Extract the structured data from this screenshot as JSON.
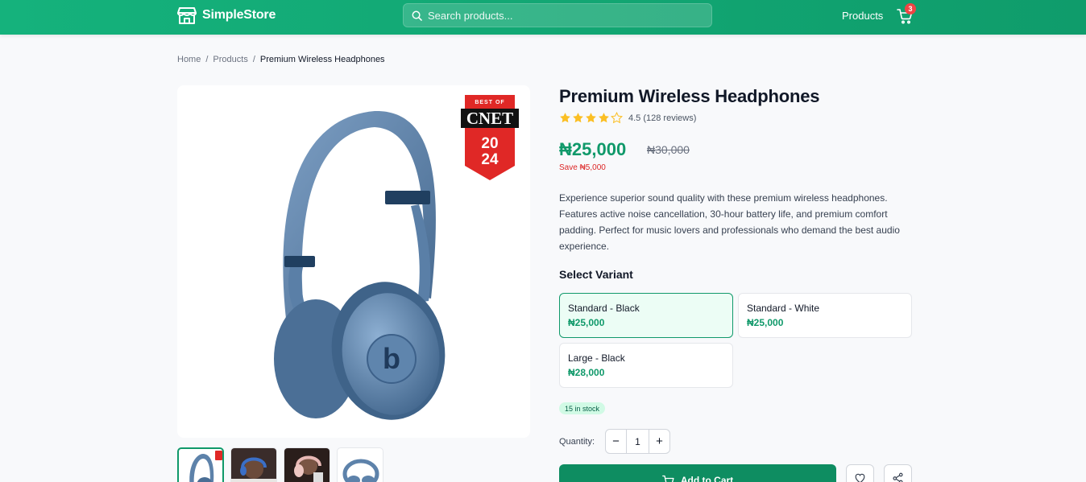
{
  "header": {
    "brand": "SimpleStore",
    "search_placeholder": "Search products...",
    "nav_products": "Products",
    "cart_count": "3"
  },
  "breadcrumb": {
    "home": "Home",
    "products": "Products",
    "current": "Premium Wireless Headphones",
    "separator": "/"
  },
  "image": {
    "badge_top": "BEST OF",
    "badge_brand": "CNET",
    "badge_year_1": "20",
    "badge_year_2": "24",
    "headphone_logo": "b"
  },
  "product": {
    "title": "Premium Wireless Headphones",
    "rating": 4.5,
    "rating_text": "4.5 (128 reviews)",
    "price": "₦25,000",
    "old_price": "₦30,000",
    "save": "Save ₦5,000",
    "description": "Experience superior sound quality with these premium wireless headphones. Features active noise cancellation, 30-hour battery life, and premium comfort padding. Perfect for music lovers and professionals who demand the best audio experience.",
    "variant_label": "Select Variant",
    "variants": [
      {
        "name": "Standard - Black",
        "price": "₦25,000",
        "selected": true
      },
      {
        "name": "Standard - White",
        "price": "₦25,000",
        "selected": false
      },
      {
        "name": "Large - Black",
        "price": "₦28,000",
        "selected": false
      }
    ],
    "stock": "15 in stock",
    "quantity_label": "Quantity:",
    "quantity": "1",
    "add_to_cart": "Add to Cart"
  },
  "colors": {
    "brand": "#10996a",
    "accent_red": "#dc2626",
    "star": "#fbbf24"
  }
}
